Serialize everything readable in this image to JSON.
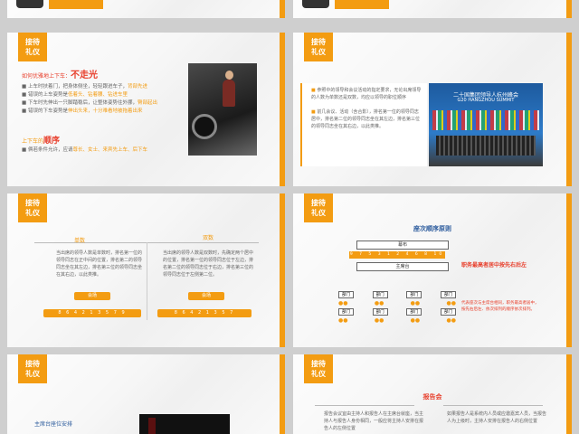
{
  "slides": {
    "s1": {
      "tag": [
        "接待",
        "礼仪"
      ],
      "heading1_prefix": "如何优雅地上下车：",
      "heading1_accent": "不走光",
      "bullets": [
        {
          "text": "上车时扶着门，把身体侧坐，轻轻跟进车子，",
          "hl": "背部先进"
        },
        {
          "text": "错误的上车姿势是",
          "hl": "低着头、钻着腰、钻进车里"
        },
        {
          "text": "下车时先伸出一只脚踏稳后，让整体姿势往外挪，",
          "hl": "臀部起出"
        },
        {
          "text": "错误的下车姿势是",
          "hl": "伸出头来，十分难看地被拖着出来"
        }
      ],
      "heading2_prefix": "上下车的",
      "heading2_accent": "顺序",
      "order_bullet_prefix": "俩若条件允许，应请",
      "order_bullet_hl": "尊长、女士、来宾先上车、后下车"
    },
    "s2": {
      "tag": [
        "接待",
        "礼仪"
      ],
      "bullets": [
        "参照中的领导和会议活动的指定要求，无论出席领导的人数为单数还是双数，均应以领导的职位顺序",
        "前几会议、活动（含合影），排名第一位的领导同志居中，排名第二位的领导同志坐在其左边，排名第三位的领导同志坐在其右边，以此类推。"
      ],
      "banner_cn": "二十国集团领导人杭州峰会",
      "banner_en": "G20 HANGZHOU SUMMIT"
    },
    "s3": {
      "tag": [
        "接待",
        "礼仪"
      ],
      "left_title": "单数",
      "left_text": "当出席的领导人数是单数时，排名第一位的领导同志在正中间的位置，排名第二的领导同志坐在其左边，排名第三位的领导同志坐在其右边，以此类推。",
      "left_pill": "会场",
      "left_seq": "8 6 4 2 1 3 5 7 9",
      "right_title": "双数",
      "right_text": "当出席的领导人数是双数时，先确定两个居中的位置，排名第一位的领导同志位于左边，排名第二位的领导同志位于右边，排名第三位的领导同志位于左侧第二位。",
      "right_pill": "会场",
      "right_seq": "8 6 4 2 1 3 5 7"
    },
    "s4": {
      "tag": [
        "接待",
        "礼仪"
      ],
      "title": "座次顺序原则",
      "curtain": "幕布",
      "main_stage": "主席台",
      "side_title": "职务最高者居中按先右后左",
      "side_text": "代表座次与主席台相同，职务最高者居中，按先右后左、依次排列的顺序依次排列。",
      "dept": "部门",
      "seq_nums": "9 7 5 3 1 2 4 6 8 10"
    },
    "s5": {
      "tag": [
        "接待",
        "礼仪"
      ],
      "label": "主席台座位安排"
    },
    "s6": {
      "tag": [
        "接待",
        "礼仪"
      ],
      "title": "报告会",
      "left_text": "报告会议宜由主持人和报告人在主席台就座，当主持人与报告人身份相同，一般应将主持人安排在报告人的左侧位置",
      "right_text": "如果报告人是系统内人员或应邀嘉宾人员，当报告人为上级时，主持人安排在报告人的右侧位置"
    }
  },
  "colors": {
    "accent": "#f39c12",
    "red": "#e8402d"
  }
}
